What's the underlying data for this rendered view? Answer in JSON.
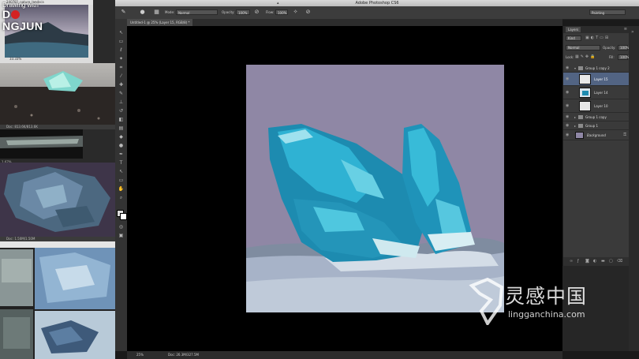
{
  "app": {
    "title": "Adobe Photoshop CS6",
    "workspace": "Painting"
  },
  "overlay": {
    "logo_line1": "Drawing with",
    "logo_line2a": "D",
    "logo_line2b": "NGJUN"
  },
  "references": {
    "window1_title": "240781_nature_landsca",
    "window1_zoom": "33.33%",
    "window2_doc": "Doc: 813.6K/813.6K",
    "window3_zoom": "1.67%",
    "window3_doc": "Doc: 1.50M/1.50M"
  },
  "options_bar": {
    "mode_label": "Mode:",
    "mode_value": "Normal",
    "opacity_label": "Opacity:",
    "opacity_value": "100%",
    "flow_label": "Flow:",
    "flow_value": "100%"
  },
  "document": {
    "tab_title": "Untitled-1 @ 25% (Layer 15, RGB/8) *",
    "zoom": "25%",
    "doc_info": "Doc: 26.3M/327.5M"
  },
  "layers_panel": {
    "tab_label": "Layers",
    "filter_value": "Kind",
    "blend_mode": "Normal",
    "opacity_label": "Opacity:",
    "opacity_value": "100%",
    "lock_label": "Lock:",
    "fill_label": "Fill:",
    "fill_value": "100%",
    "layers": [
      {
        "name": "Group 1 copy 2",
        "kind": "group",
        "selected": false
      },
      {
        "name": "Layer 15",
        "kind": "layer",
        "selected": true
      },
      {
        "name": "Layer 14",
        "kind": "layer",
        "selected": false
      },
      {
        "name": "Layer 10",
        "kind": "layer",
        "selected": false
      },
      {
        "name": "Group 1 copy",
        "kind": "group",
        "selected": false
      },
      {
        "name": "Group 1",
        "kind": "group",
        "selected": false
      },
      {
        "name": "Background",
        "kind": "background",
        "selected": false
      }
    ]
  },
  "watermark": {
    "cn": "灵感中国",
    "url": "lingganchina.com"
  },
  "colors": {
    "canvas_bg": "#8f87a5",
    "crystal": "#2aa3c4",
    "selection": "#526483"
  }
}
